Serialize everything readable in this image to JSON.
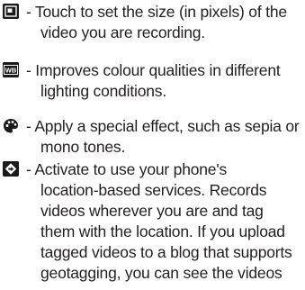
{
  "items": [
    {
      "icon": "video-size-icon",
      "lines": [
        "- Touch to set the size (in pixels) of the",
        "video you are recording."
      ]
    },
    {
      "icon": "white-balance-icon",
      "icon_text": "WB",
      "lines": [
        "- Improves colour qualities in different",
        "lighting conditions."
      ]
    },
    {
      "icon": "color-effect-icon",
      "lines": [
        "- Apply a special effect, such as sepia or",
        "mono tones."
      ]
    },
    {
      "icon": "geotagging-icon",
      "lines": [
        "- Activate to use your phone's",
        "location-based services. Records",
        "videos wherever you are and tag",
        "them with the location. If you upload",
        "tagged videos to a blog that supports",
        "geotagging, you can see the videos"
      ]
    }
  ]
}
